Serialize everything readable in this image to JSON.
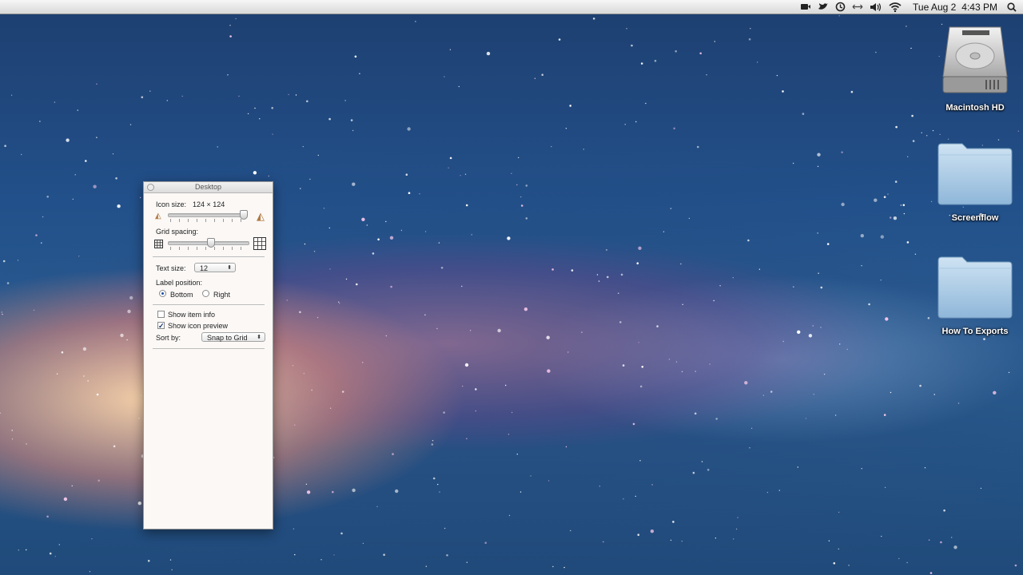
{
  "menubar": {
    "icons": [
      "screen-record-icon",
      "twitter-bird-icon",
      "time-machine-icon",
      "network-arrows-icon",
      "volume-icon",
      "wifi-icon",
      "spotlight-search-icon"
    ],
    "clock_day": "Tue Aug 2",
    "clock_time": "4:43 PM"
  },
  "desktop": {
    "icons": [
      {
        "label": "Macintosh HD",
        "kind": "hard-drive-icon"
      },
      {
        "label": "Screenflow",
        "kind": "folder-icon"
      },
      {
        "label": "How To Exports",
        "kind": "folder-icon"
      }
    ]
  },
  "panel": {
    "title": "Desktop",
    "icon_size_label": "Icon size:",
    "icon_size_value": "124 × 124",
    "icon_size_level": 0.98,
    "grid_spacing_label": "Grid spacing:",
    "grid_spacing_level": 0.5,
    "text_size_label": "Text size:",
    "text_size_value": "12",
    "label_position_label": "Label position:",
    "label_bottom": "Bottom",
    "label_right": "Right",
    "label_position_selected": "Bottom",
    "show_item_info": "Show item info",
    "show_item_info_checked": false,
    "show_icon_preview": "Show icon preview",
    "show_icon_preview_checked": true,
    "sort_by_label": "Sort by:",
    "sort_by_value": "Snap to Grid"
  }
}
